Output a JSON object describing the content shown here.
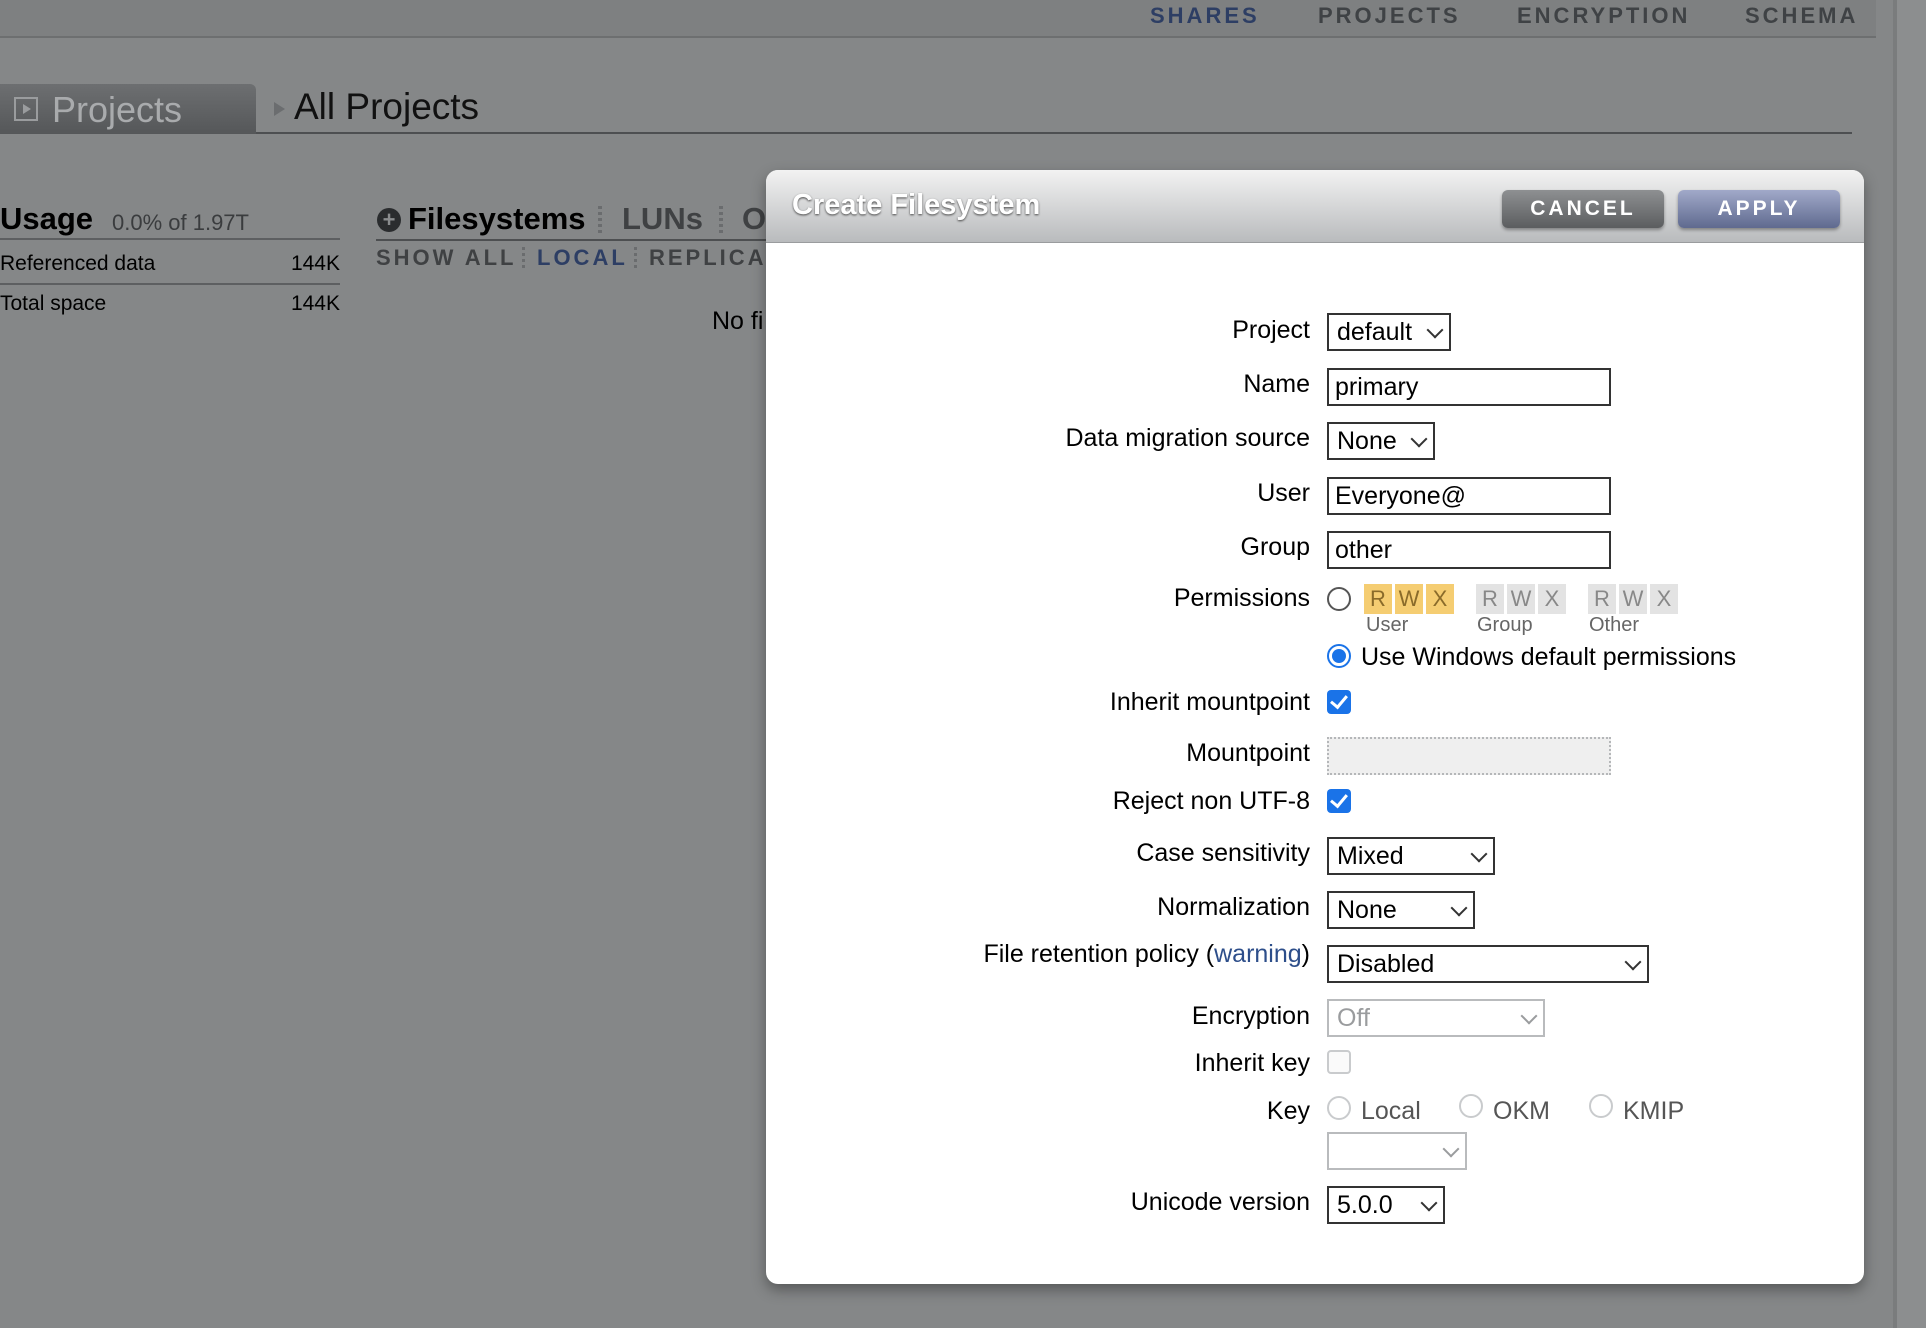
{
  "nav": {
    "tabs": [
      "SHARES",
      "PROJECTS",
      "ENCRYPTION",
      "SCHEMA"
    ],
    "active": "SHARES"
  },
  "header": {
    "section": "Projects",
    "breadcrumb": "All Projects"
  },
  "usage": {
    "title": "Usage",
    "summary": "0.0% of 1.97T",
    "rows": [
      {
        "label": "Referenced data",
        "value": "144K"
      },
      {
        "label": "Total space",
        "value": "144K"
      }
    ]
  },
  "shares": {
    "tabs": [
      "Filesystems",
      "LUNs",
      "O"
    ],
    "filters": [
      "SHOW ALL",
      "LOCAL",
      "REPLICA"
    ],
    "active_filter": "LOCAL",
    "empty_text": "No fi"
  },
  "dialog": {
    "title": "Create Filesystem",
    "cancel_label": "CANCEL",
    "apply_label": "APPLY",
    "fields": {
      "project": {
        "label": "Project",
        "value": "default"
      },
      "name": {
        "label": "Name",
        "value": "primary"
      },
      "migration": {
        "label": "Data migration source",
        "value": "None"
      },
      "user": {
        "label": "User",
        "value": "Everyone@"
      },
      "group": {
        "label": "Group",
        "value": "other"
      },
      "permissions": {
        "label": "Permissions",
        "bits": [
          "R",
          "W",
          "X"
        ],
        "user_label": "User",
        "group_label": "Group",
        "other_label": "Other",
        "windows_label": "Use Windows default permissions"
      },
      "inherit_mountpoint": {
        "label": "Inherit mountpoint",
        "checked": true
      },
      "mountpoint": {
        "label": "Mountpoint",
        "value": ""
      },
      "reject_utf8": {
        "label": "Reject non UTF-8",
        "checked": true
      },
      "case_sensitivity": {
        "label": "Case sensitivity",
        "value": "Mixed"
      },
      "normalization": {
        "label": "Normalization",
        "value": "None"
      },
      "retention": {
        "label_prefix": "File retention policy (",
        "link": "warning",
        "label_suffix": ")",
        "value": "Disabled"
      },
      "encryption": {
        "label": "Encryption",
        "value": "Off"
      },
      "inherit_key": {
        "label": "Inherit key",
        "checked": false
      },
      "key": {
        "label": "Key",
        "options": [
          "Local",
          "OKM",
          "KMIP"
        ],
        "value": ""
      },
      "unicode": {
        "label": "Unicode version",
        "value": "5.0.0"
      }
    }
  },
  "colors": {
    "accent": "#1a73e8",
    "permission_on": "#f5cd72",
    "backdrop": "#858788",
    "nav_active": "#2d3e64"
  }
}
